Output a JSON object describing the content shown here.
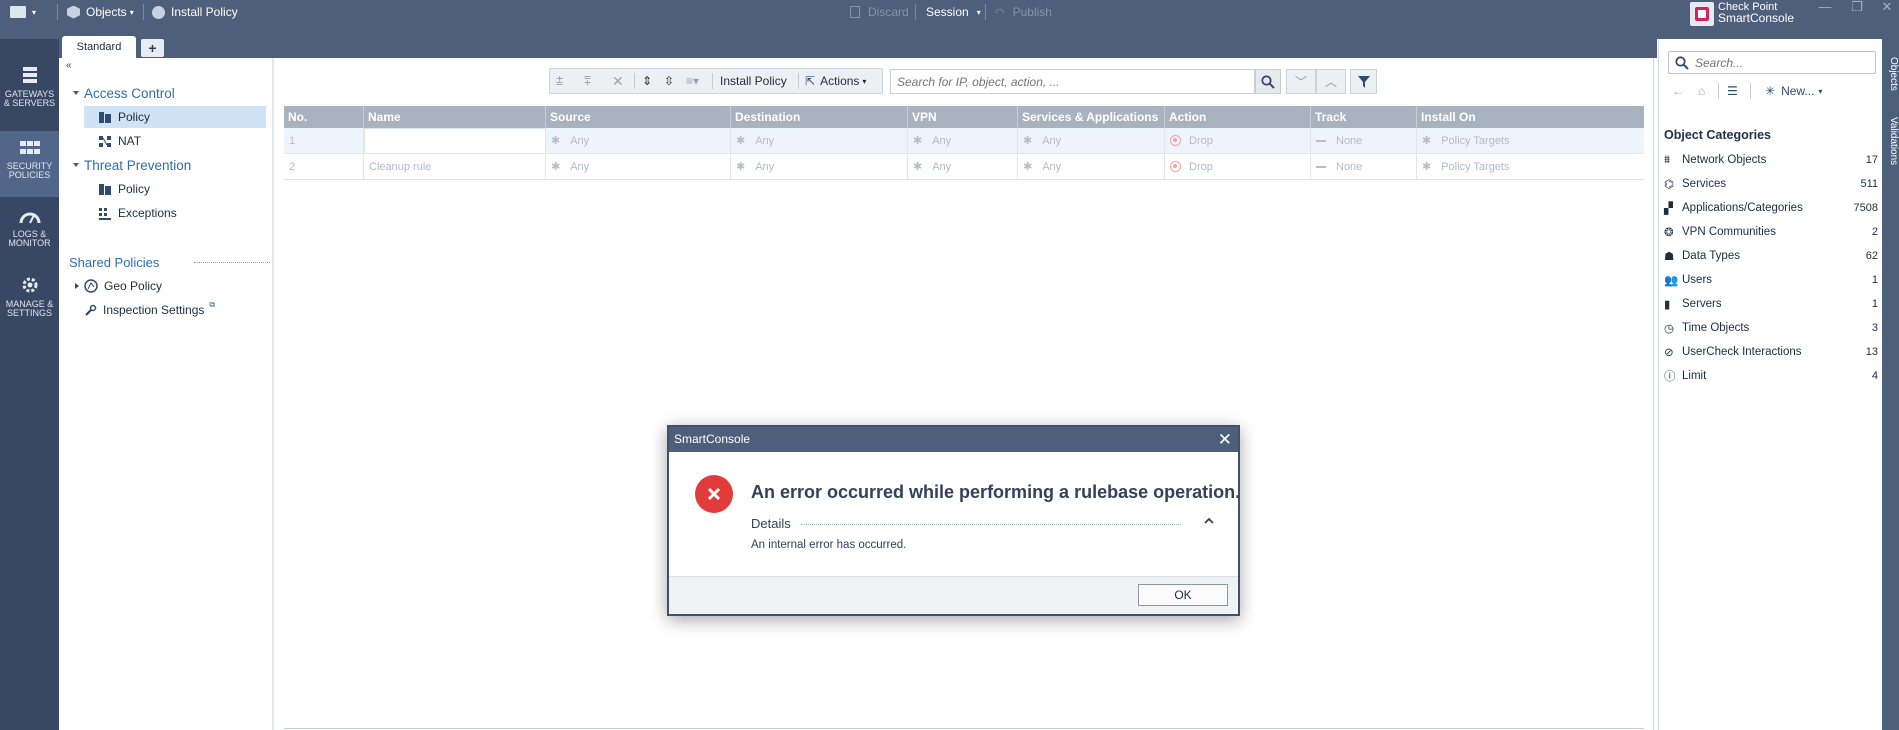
{
  "topbar": {
    "menu_icon": "app-menu-icon",
    "objects_label": "Objects",
    "install_policy_label": "Install Policy",
    "discard_label": "Discard",
    "session_label": "Session",
    "publish_label": "Publish",
    "brand_line1": "Check Point",
    "brand_line2": "SmartConsole"
  },
  "leftnav": [
    {
      "line1": "GATEWAYS",
      "line2": "& SERVERS",
      "icon": "gateways-icon",
      "active": false
    },
    {
      "line1": "SECURITY",
      "line2": "POLICIES",
      "icon": "security-policies-icon",
      "active": true
    },
    {
      "line1": "LOGS &",
      "line2": "MONITOR",
      "icon": "logs-monitor-icon",
      "active": false
    },
    {
      "line1": "MANAGE &",
      "line2": "SETTINGS",
      "icon": "manage-settings-icon",
      "active": false
    }
  ],
  "tabs": {
    "active": "Standard",
    "add": "+"
  },
  "tree": {
    "access_control": "Access Control",
    "ac_policy": "Policy",
    "ac_nat": "NAT",
    "threat_prevention": "Threat Prevention",
    "tp_policy": "Policy",
    "tp_exceptions": "Exceptions",
    "shared_policies": "Shared Policies",
    "geo_policy": "Geo Policy",
    "inspection_settings": "Inspection Settings"
  },
  "toolbar": {
    "install_policy": "Install Policy",
    "actions": "Actions",
    "search_placeholder": "Search for IP, object, action, ..."
  },
  "table": {
    "columns": [
      "No.",
      "Name",
      "Source",
      "Destination",
      "VPN",
      "Services & Applications",
      "Action",
      "Track",
      "Install On"
    ],
    "rows": [
      {
        "no": "1",
        "name": "",
        "source": "Any",
        "destination": "Any",
        "vpn": "Any",
        "services": "Any",
        "action": "Drop",
        "track": "None",
        "install_on": "Policy Targets"
      },
      {
        "no": "2",
        "name": "Cleanup rule",
        "source": "Any",
        "destination": "Any",
        "vpn": "Any",
        "services": "Any",
        "action": "Drop",
        "track": "None",
        "install_on": "Policy Targets"
      }
    ]
  },
  "objects": {
    "search_placeholder": "Search...",
    "new_label": "New...",
    "title": "Object Categories",
    "categories": [
      {
        "label": "Network Objects",
        "count": "17",
        "icon": "network-objects-icon"
      },
      {
        "label": "Services",
        "count": "511",
        "icon": "services-icon"
      },
      {
        "label": "Applications/Categories",
        "count": "7508",
        "icon": "applications-icon"
      },
      {
        "label": "VPN Communities",
        "count": "2",
        "icon": "vpn-communities-icon"
      },
      {
        "label": "Data Types",
        "count": "62",
        "icon": "data-types-icon"
      },
      {
        "label": "Users",
        "count": "1",
        "icon": "users-icon"
      },
      {
        "label": "Servers",
        "count": "1",
        "icon": "servers-icon"
      },
      {
        "label": "Time Objects",
        "count": "3",
        "icon": "time-objects-icon"
      },
      {
        "label": "UserCheck Interactions",
        "count": "13",
        "icon": "usercheck-icon"
      },
      {
        "label": "Limit",
        "count": "4",
        "icon": "limit-icon"
      }
    ],
    "side_tabs": [
      "Objects",
      "Validations"
    ]
  },
  "dialog": {
    "title": "SmartConsole",
    "close": "✕",
    "message": "An error occurred while performing a rulebase operation.",
    "details_label": "Details",
    "details_text": "An internal error has occurred.",
    "ok_label": "OK"
  },
  "colors": {
    "topbar": "#4e5f7c",
    "leftnav": "#384763",
    "accent_link": "#2e6eb0",
    "error_red": "#e23b3b",
    "header_gray": "#a9b2bf"
  }
}
